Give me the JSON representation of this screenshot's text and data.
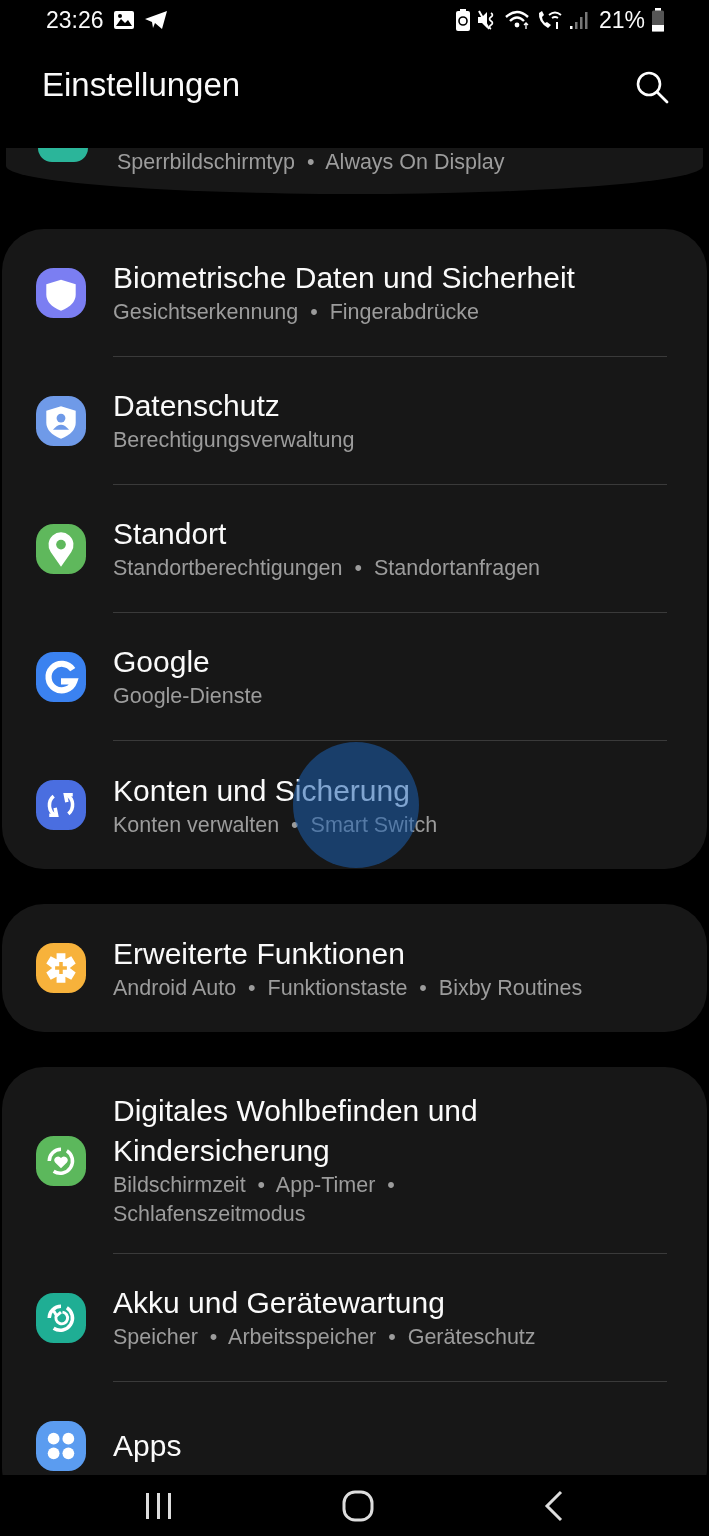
{
  "status_bar": {
    "time": "23:26",
    "battery_percent": "21%"
  },
  "app_bar": {
    "title": "Einstellungen"
  },
  "partial_card": {
    "subtitle": "Sperrbildschirmtyp  •  Always On Display",
    "color": "#2bb59a"
  },
  "groups": [
    {
      "items": [
        {
          "title": "Biometrische Daten und Sicherheit",
          "subtitle": [
            "Gesichtserkennung  •  Fingerabdrücke"
          ],
          "color": "#7b7ef2",
          "pressed": false
        },
        {
          "title": "Datenschutz",
          "subtitle": [
            "Berechtigungsverwaltung"
          ],
          "color": "#6f9ae8",
          "pressed": false
        },
        {
          "title": "Standort",
          "subtitle": [
            "Standortberechtigungen  •  Standortanfragen"
          ],
          "color": "#5fb85c",
          "pressed": false
        },
        {
          "title": "Google",
          "subtitle": [
            "Google-Dienste"
          ],
          "color": "#3b82f0",
          "pressed": false
        },
        {
          "title": "Konten und Sicherung",
          "subtitle": [
            "Konten verwalten  •  Smart Switch"
          ],
          "color": "#4a6ee0",
          "pressed": true
        }
      ]
    },
    {
      "items": [
        {
          "title": "Erweiterte Funktionen",
          "subtitle": [
            "Android Auto  •  Funktionstaste  •  Bixby Routines"
          ],
          "color": "#f7b23b",
          "pressed": false
        }
      ]
    },
    {
      "items": [
        {
          "title": "Digitales Wohlbefinden und Kindersicherung",
          "subtitle": [
            "Bildschirmzeit  •  App-Timer  •",
            "Schlafenszeitmodus"
          ],
          "color": "#5cb85c",
          "pressed": false
        },
        {
          "title": "Akku und Gerätewartung",
          "subtitle": [
            "Speicher  •  Arbeitsspeicher  •  Geräteschutz"
          ],
          "color": "#1fae94",
          "pressed": false
        },
        {
          "title": "Apps",
          "color": "#5b9cf0",
          "pressed": false
        }
      ]
    }
  ]
}
